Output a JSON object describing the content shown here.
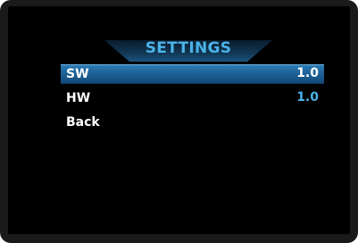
{
  "screen": {
    "title": "SETTINGS"
  },
  "menu": {
    "items": [
      {
        "label": "SW",
        "value": "1.0",
        "selected": true
      },
      {
        "label": "HW",
        "value": "1.0",
        "selected": false
      },
      {
        "label": "Back",
        "value": "",
        "selected": false
      }
    ]
  },
  "colors": {
    "accent": "#4ab3e8",
    "selection": "#1c5f94",
    "background": "#000000",
    "bezel": "#1a1a1a"
  }
}
